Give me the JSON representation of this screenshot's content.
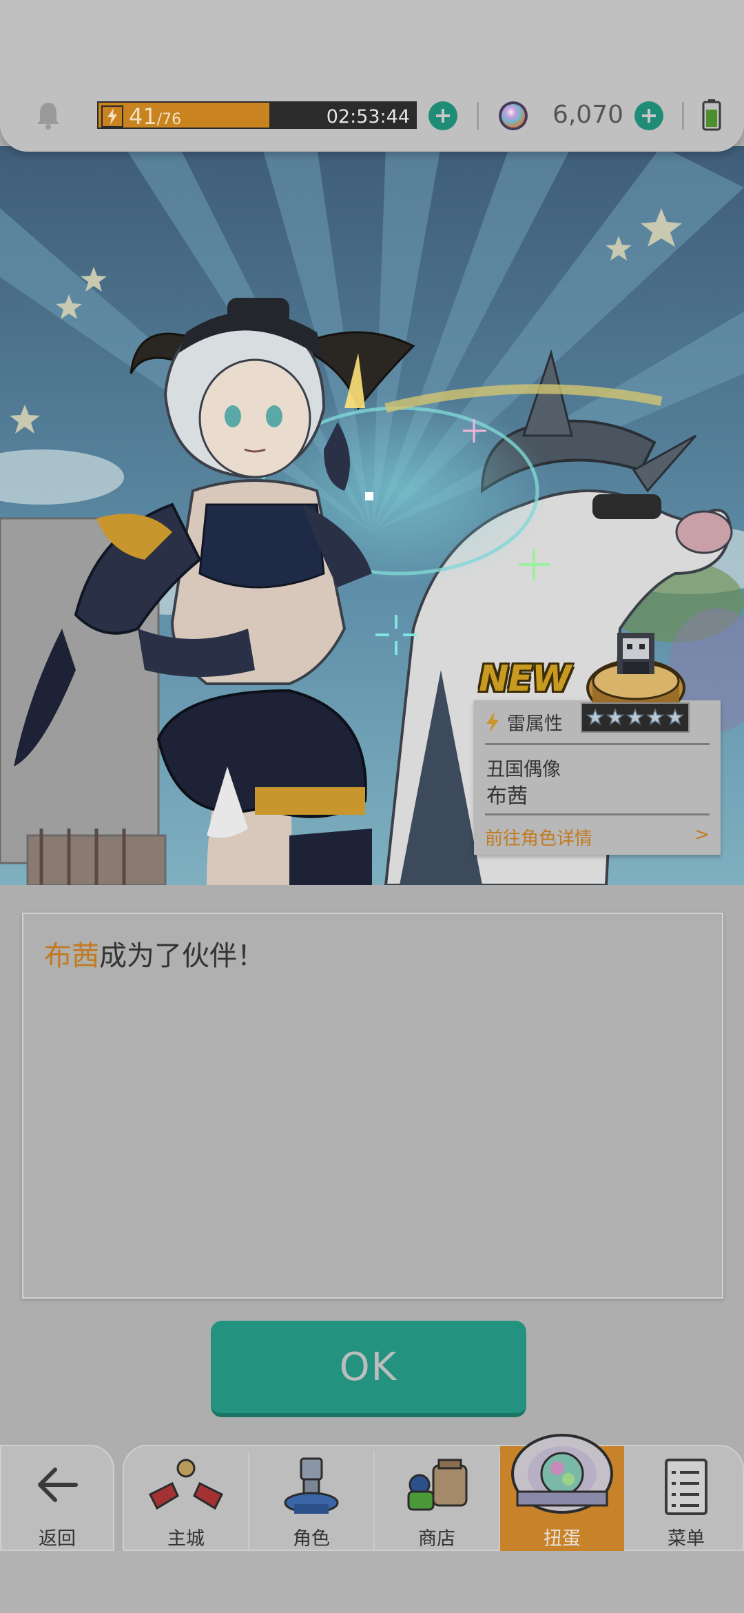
{
  "status_bar": {
    "stamina_current": "41",
    "stamina_max": "/76",
    "stamina_fraction": 0.54,
    "stamina_timer": "02:53:44",
    "gem_count": "6,070"
  },
  "character_card": {
    "new_label": "NEW",
    "attribute": "雷属性",
    "rarity_stars": 5,
    "title": "丑国偶像",
    "name": "布茜",
    "detail_link": "前往角色详情",
    "detail_arrow": ">"
  },
  "message": {
    "name": "布茜",
    "text": "成为了伙伴！"
  },
  "ok_button": {
    "label": "OK"
  },
  "nav": {
    "back": "返回",
    "items": [
      {
        "label": "主城",
        "icon": "castle-icon"
      },
      {
        "label": "角色",
        "icon": "character-icon"
      },
      {
        "label": "商店",
        "icon": "shop-icon"
      },
      {
        "label": "扭蛋",
        "icon": "gacha-icon",
        "active": true
      },
      {
        "label": "菜单",
        "icon": "menu-icon"
      }
    ]
  },
  "colors": {
    "accent_orange": "#c8822a",
    "accent_teal": "#23927f",
    "name_highlight": "#c27a1f"
  }
}
